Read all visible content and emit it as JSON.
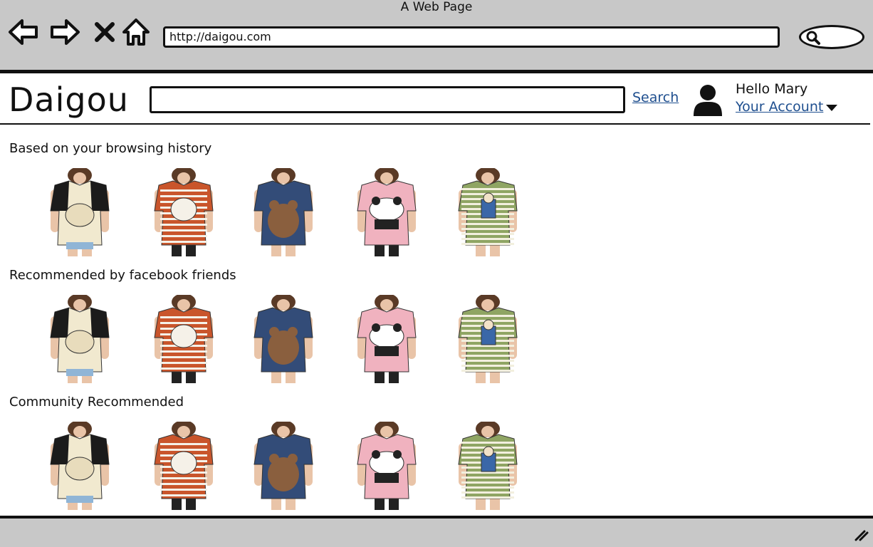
{
  "window": {
    "title": "A Web Page"
  },
  "browser": {
    "url": "http://daigou.com",
    "icons": [
      "back-arrow-icon",
      "forward-arrow-icon",
      "close-x-icon",
      "home-icon",
      "search-icon"
    ]
  },
  "header": {
    "logo": "Daigou",
    "search_value": "",
    "search_link": "Search",
    "greeting": "Hello Mary",
    "account_link": "Your Account"
  },
  "sections": [
    {
      "title": "Based on your browsing history"
    },
    {
      "title": "Recommended by facebook friends"
    },
    {
      "title": "Community Recommended"
    }
  ],
  "products": [
    {
      "name": "black-cream-cat-tshirt",
      "colors": [
        "#f1e9cf",
        "#1b1b1b",
        "#90b5d6"
      ]
    },
    {
      "name": "orange-striped-cat-tunic",
      "colors": [
        "#c9552b",
        "#f5f1e8",
        "#222222"
      ]
    },
    {
      "name": "navy-bear-tunic",
      "colors": [
        "#334c78",
        "#8a5f3e",
        "#d9c9b7"
      ]
    },
    {
      "name": "pink-panda-hoodie",
      "colors": [
        "#f0b2bf",
        "#ffffff",
        "#222222"
      ]
    },
    {
      "name": "green-striped-pocket-sweater",
      "colors": [
        "#8fa563",
        "#f2efde",
        "#3a67a8"
      ]
    }
  ]
}
